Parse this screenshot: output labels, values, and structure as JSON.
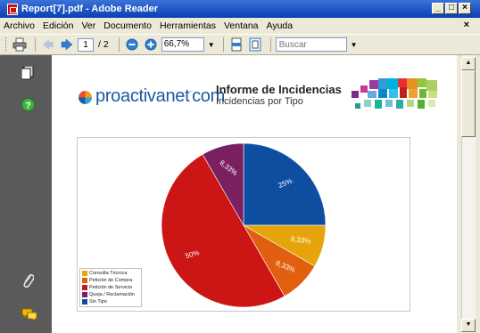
{
  "window": {
    "title": "Report[7].pdf - Adobe Reader",
    "controls": [
      "_",
      "□",
      "×"
    ]
  },
  "menu": {
    "items": [
      "Archivo",
      "Edición",
      "Ver",
      "Documento",
      "Herramientas",
      "Ventana",
      "Ayuda"
    ],
    "close": "×"
  },
  "toolbar": {
    "current_page": "1",
    "total_pages": "/ 2",
    "zoom": "66,7%",
    "search_placeholder": "Buscar",
    "icons": [
      "print-icon",
      "previous-page-icon",
      "next-page-icon",
      "zoom-out-icon",
      "zoom-in-icon",
      "fit-width-icon",
      "fit-page-icon"
    ]
  },
  "sidebar": {
    "icons": [
      "pages-icon",
      "help-icon",
      "attachment-icon",
      "comments-icon"
    ]
  },
  "report": {
    "logo_text": "proactivanet",
    "logo_suffix": "com",
    "title": "Informe de Incidencias",
    "subtitle": "Incidencias por Tipo"
  },
  "chart_data": {
    "type": "pie",
    "title": "",
    "slices": [
      {
        "name": "Sin Tipo",
        "value": 25,
        "label": "25%",
        "color": "#0d4ea0"
      },
      {
        "name": "Consulta Técnica",
        "value": 8.33,
        "label": "8,33%",
        "color": "#e5a50a"
      },
      {
        "name": "Petición de Compra",
        "value": 8.33,
        "label": "8,33%",
        "color": "#e06010"
      },
      {
        "name": "Petición de Servicio",
        "value": 50,
        "label": "50%",
        "color": "#cc1515"
      },
      {
        "name": "Queja / Reclamación",
        "value": 8.33,
        "label": "8,33%",
        "color": "#7a2060"
      }
    ],
    "legend": [
      {
        "name": "Consulta Técnica",
        "color": "#e5a50a"
      },
      {
        "name": "Petición de Compra",
        "color": "#e06010"
      },
      {
        "name": "Petición de Servicio",
        "color": "#cc1515"
      },
      {
        "name": "Queja / Reclamación",
        "color": "#7a2060"
      },
      {
        "name": "Sin Tipo",
        "color": "#0d4ea0"
      }
    ],
    "legend_position": "bottom-left"
  }
}
